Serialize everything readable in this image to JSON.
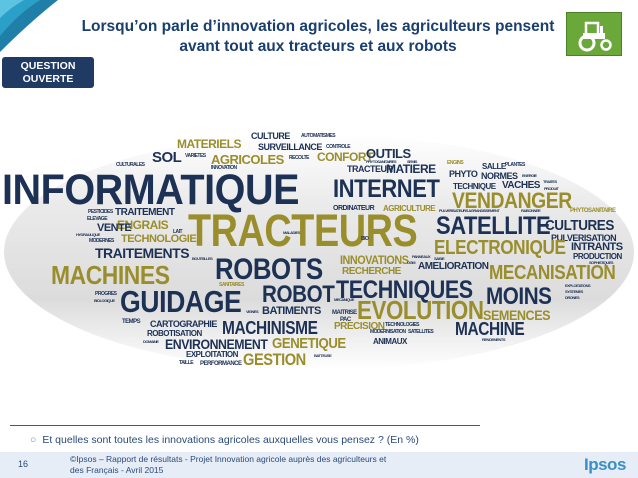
{
  "title": "Lorsqu’on parle d’innovation agricoles, les agriculteurs pensent avant tout aux tracteurs et aux robots",
  "question_badge": {
    "line1": "QUESTION",
    "line2": "OUVERTE"
  },
  "word_cloud": {
    "informatique": "INFORMATIQUE",
    "tracteurs": "TRACTEURS",
    "machines": "MACHINES",
    "robots": "ROBOTS",
    "guidage": "GUIDAGE",
    "robot": "ROBOT",
    "techniques": "TECHNIQUES",
    "evolution": "EVOLUTION",
    "moins": "MOINS",
    "mecanisation": "MECANISATION",
    "internet": "INTERNET",
    "satellite": "SATELLITE",
    "electronique": "ELECTRONIQUE",
    "vendanger": "VENDANGER",
    "cultures": "CULTURES",
    "machine": "MACHINE",
    "machinisme": "MACHINISME",
    "genetique": "GENETIQUE",
    "gestion": "GESTION",
    "environnement": "ENVIRONNEMENT",
    "traitements": "TRAITEMENTS",
    "materiels": "MATERIELS",
    "sol": "SOL",
    "agricoles": "AGRICOLES",
    "culture": "CULTURE",
    "surveillance": "SURVEILLANCE",
    "confort": "CONFORT",
    "outils": "OUTILS",
    "tracteur": "TRACTEUR",
    "matiere": "MATIERE",
    "engrais": "ENGRAIS",
    "vente": "VENTE",
    "technologie": "TECHNOLOGIE",
    "traitement": "TRAITEMENT",
    "batiments": "BATIMENTS",
    "precision": "PRECISION",
    "cartographie": "CARTOGRAPHIE",
    "robotisation": "ROBOTISATION",
    "exploitation": "EXPLOITATION",
    "performance": "PERFORMANCE",
    "innovations": "INNOVATIONS",
    "recherche": "RECHERCHE",
    "amelioration": "AMELIORATION",
    "semences": "SEMENCES",
    "intrants": "INTRANTS",
    "pulverisation": "PULVERISATION",
    "production": "PRODUCTION",
    "technique": "TECHNIQUE",
    "vaches": "VACHES",
    "normes": "NORMES",
    "phyto": "PHYTO",
    "salle": "SALLE",
    "plantes": "PLANTES",
    "ordinateur": "ORDINATEUR",
    "agriculture": "AGRICULTURE",
    "animaux": "ANIMAUX",
    "technologies": "TECHNOLOGIES",
    "modernisation": "MODERNISATION",
    "satellites": "SATELLITES",
    "sanitaires": "SANITAIRES",
    "varietes": "VARIETES",
    "recolte": "RECOLTE",
    "automatismes": "AUTOMATISMES",
    "controle": "CONTROLE",
    "culturales": "CULTURALES",
    "elevage": "ELEVAGE",
    "modernes": "MODERNES",
    "progres": "PROGRES",
    "temps": "TEMPS",
    "taille": "TAILLE",
    "maladies": "MALADIES",
    "bio": "BIO",
    "energie": "ENERGIE",
    "phytosanitaire": "PHYTOSANITAIRE",
    "produit": "PRODUIT",
    "moins_exploitations": "EXPLOITATIONS",
    "systemes": "SYSTEMES",
    "drones": "DRONES",
    "pac": "PAC",
    "maitrise": "MAITRISE",
    "batteuse": "BATTEUSE",
    "rendements": "RENDEMENTS",
    "pesticides": "PESTICIDES",
    "hydraulique": "HYDRAULIQUE",
    "lait": "LAIT",
    "biologique": "BIOLOGIQUE",
    "semis": "SEMIS",
    "engins": "ENGINS",
    "traites": "TRAITES",
    "pulverisateurs": "PULVERISATEURS AGRANDISSEMENT",
    "raisonnee": "RAISONNEE",
    "sophistiques": "SOPHISTIQUES",
    "mecanique": "MECANIQUE",
    "vignes": "VIGNES",
    "bouteilles": "BOUTEILLES",
    "donnees": "DONNEES",
    "domaine": "DOMAINE",
    "panneaux": "PANNEAUX",
    "ogm": "OGM",
    "innovation": "INNOVATION",
    "saisie": "SAISIE",
    "phytosanitaires": "PHYTOSANITAIRES"
  },
  "question_text": "Et quelles sont toutes les innovations agricoles auxquelles vous pensez ? (En %)",
  "page_number": "16",
  "copyright": "©Ipsos – Rapport de résultats - Projet Innovation agricole auprès des agriculteurs et des Français - Avril 2015",
  "logo": "Ipsos",
  "colors": {
    "navy": "#1f3a63",
    "green": "#6aa83a",
    "title": "#1a3e6e"
  }
}
